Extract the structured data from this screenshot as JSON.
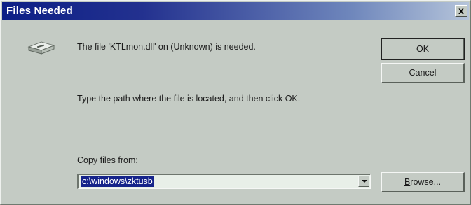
{
  "window": {
    "title": "Files Needed",
    "close_label": "x"
  },
  "message": {
    "needed": "The file 'KTLmon.dll' on (Unknown) is needed.",
    "instruction": "Type the path where the file is located, and then click OK."
  },
  "buttons": {
    "ok": "OK",
    "cancel": "Cancel",
    "browse_accel": "B",
    "browse_rest": "rowse..."
  },
  "copy_from": {
    "label_accel": "C",
    "label_rest": "opy files from:",
    "value": "c:\\windows\\zktusb"
  },
  "icons": {
    "disk": "floppy-drive-icon",
    "dropdown": "chevron-down-icon"
  },
  "colors": {
    "titlebar_start": "#0c1f86",
    "titlebar_end": "#b5c4da",
    "face": "#c4cbc4",
    "selection": "#15238a"
  }
}
